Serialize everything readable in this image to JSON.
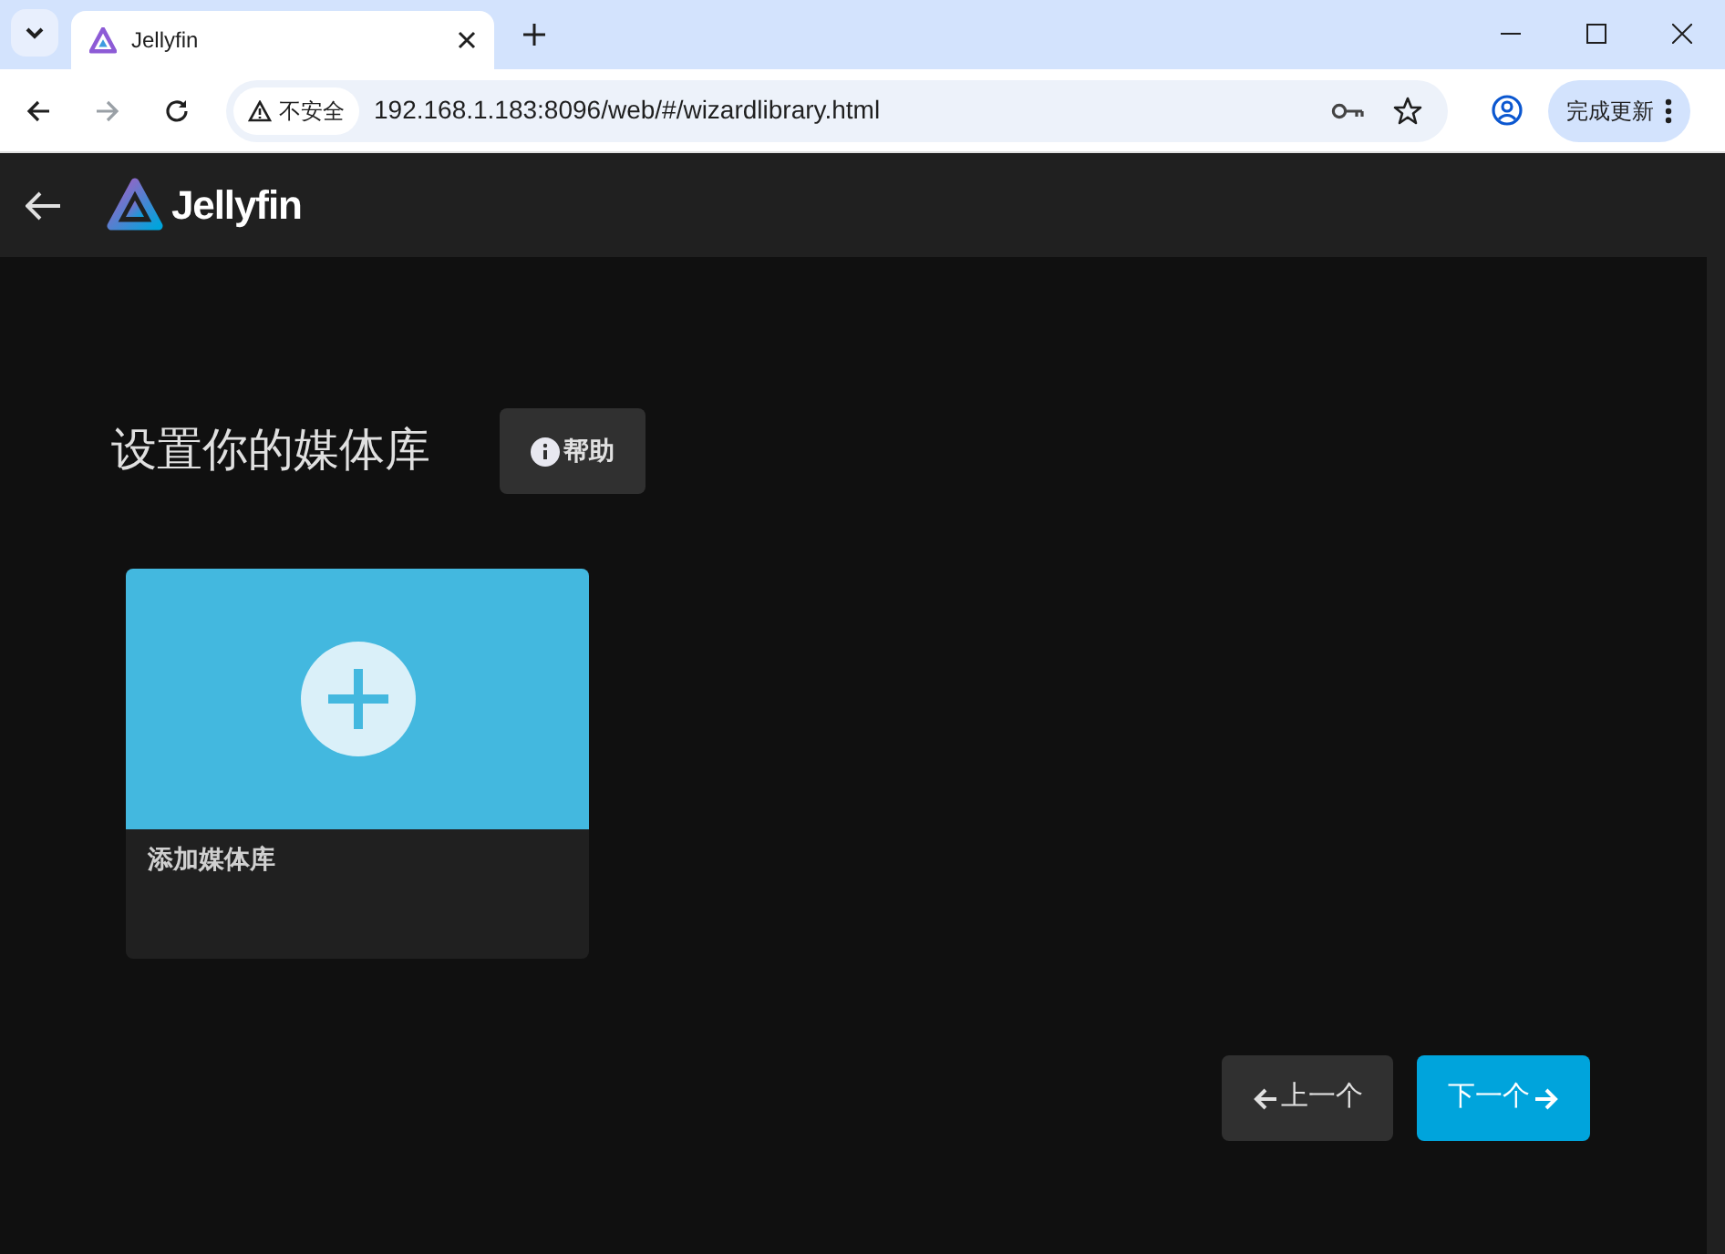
{
  "browser": {
    "tab_title": "Jellyfin",
    "security_label": "不安全",
    "url": "192.168.1.183:8096/web/#/wizardlibrary.html",
    "update_button": "完成更新"
  },
  "header": {
    "app_name": "Jellyfin"
  },
  "page": {
    "title": "设置你的媒体库",
    "help_button": "帮助"
  },
  "libraries": [
    {
      "kind": "add",
      "label": "添加媒体库"
    }
  ],
  "navigation": {
    "previous": "上一个",
    "next": "下一个"
  }
}
